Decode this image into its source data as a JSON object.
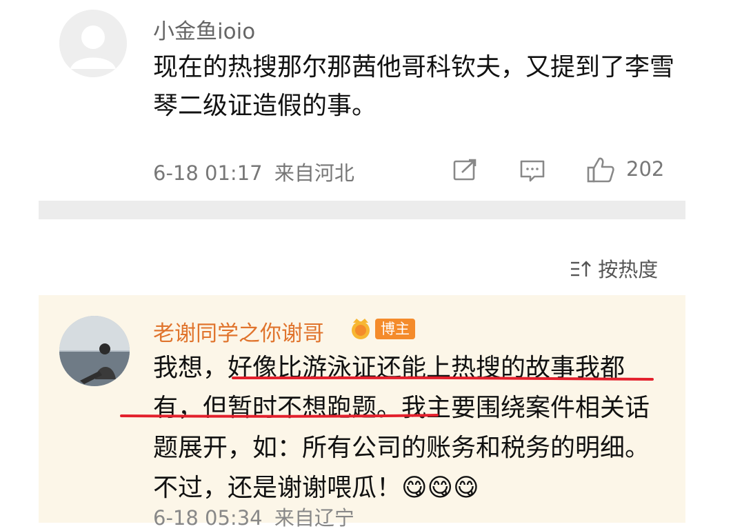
{
  "comment1": {
    "username": "小金鱼ioio",
    "text": "现在的热搜那尔那茜他哥科钦夫，又提到了李雪琴二级证造假的事。",
    "date": "6-18 01:17",
    "location": "来自河北",
    "like_count": "202",
    "share_icon": "share-icon",
    "comment_icon": "comment-icon",
    "like_icon": "thumbs-up-icon"
  },
  "sort": {
    "icon": "sort-icon",
    "label": "按热度"
  },
  "comment2": {
    "username": "老谢同学之你谢哥",
    "badge_label": "博主",
    "text_part1": "我想，",
    "text_underlined": "好像比游泳证还能上热搜的故事我都有，但暂时不想跑题",
    "text_part2": "。我主要围绕案件相关话题展开，如：所有公司的账务和税务的明细。不过，还是谢谢喂瓜！",
    "emojis": [
      "😋",
      "😋",
      "😋"
    ],
    "date": "6-18 05:34",
    "location": "来自辽宁"
  },
  "colors": {
    "highlight_bg": "#fcf6e8",
    "username_accent": "#e0742d",
    "badge_bg": "#f48b2b",
    "underline": "#e3202c"
  }
}
